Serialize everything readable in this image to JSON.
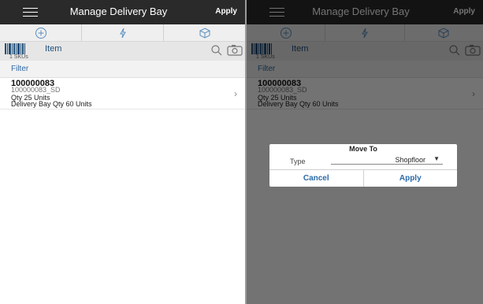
{
  "app": {
    "title": "Manage Delivery Bay",
    "apply_label": "Apply"
  },
  "actions": {
    "icons": [
      "plus-circle-icon",
      "lightning-icon",
      "cube-icon"
    ],
    "accent_color": "#5a8fc0"
  },
  "item_bar": {
    "label": "Item",
    "sku_count": "1 SKUs"
  },
  "filter": {
    "label": "Filter"
  },
  "sku": {
    "number": "100000083",
    "sub_id": "100000083_SD",
    "qty": "Qty 25 Units",
    "bay_qty": "Delivery Bay Qty 60 Units"
  },
  "dialog": {
    "title": "Move To",
    "type_label": "Type",
    "type_value": "Shopfloor",
    "cancel_label": "Cancel",
    "apply_label": "Apply"
  },
  "colors": {
    "header_bg": "#2a2a2a",
    "link_blue": "#2d6aa3"
  }
}
